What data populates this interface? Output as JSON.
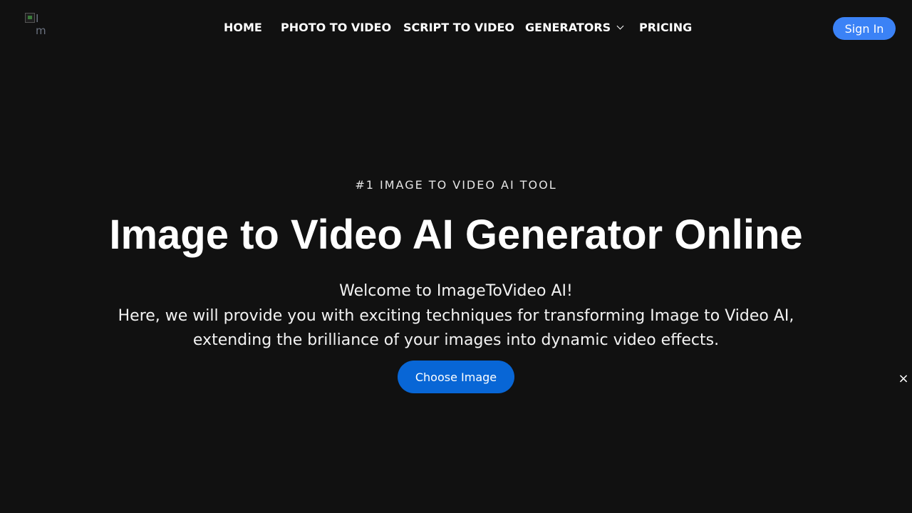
{
  "header": {
    "logo_alt": "ImageToVideo",
    "nav": {
      "home": "HOME",
      "photo_to_video": "PHOTO TO VIDEO",
      "script_to_video": "SCRIPT TO VIDEO",
      "generators": "GENERATORS",
      "pricing": "PRICING"
    },
    "sign_in": "Sign In"
  },
  "hero": {
    "eyebrow": "#1 IMAGE TO VIDEO AI TOOL",
    "title": "Image to Video AI Generator Online",
    "lines": [
      "Welcome to ImageToVideo AI!",
      "Here, we will provide you with exciting techniques for transforming Image to Video AI,",
      "extending the brilliance of your images into dynamic video effects."
    ],
    "cta": "Choose Image"
  },
  "overlay": {
    "close_symbol": "×"
  },
  "colors": {
    "background": "#111111",
    "sign_in_bg": "#3b82f6",
    "cta_bg": "#0866d6",
    "text": "#ffffff"
  },
  "icons": {
    "logo": "broken-image-icon",
    "generators_dropdown": "chevron-down-icon",
    "close": "close-icon"
  }
}
